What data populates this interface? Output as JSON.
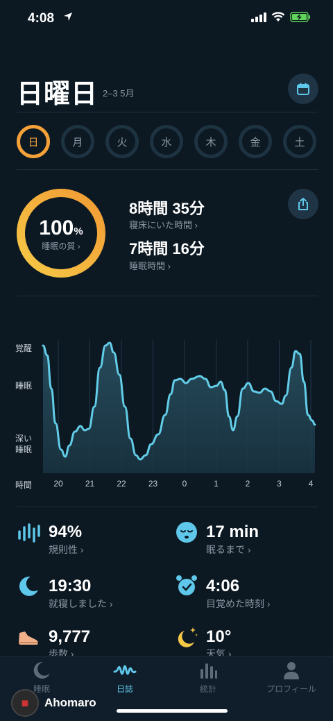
{
  "status_bar": {
    "time": "4:08"
  },
  "header": {
    "title": "日曜日",
    "date_range": "2–3 5月"
  },
  "days": [
    "日",
    "月",
    "火",
    "水",
    "木",
    "金",
    "土"
  ],
  "selected_day_index": 0,
  "summary": {
    "quality_value": "100",
    "quality_unit": "%",
    "quality_label": "睡眠の質 ›",
    "quality_fraction": 1.0,
    "time_in_bed": "8時間 35分",
    "time_in_bed_label": "寝床にいた時間 ›",
    "sleep_time": "7時間 16分",
    "sleep_time_label": "睡眠時間 ›"
  },
  "graph": {
    "y_labels": {
      "awake": "覚醒",
      "sleep": "睡眠",
      "deep": "深い\n睡眠"
    },
    "x_title": "時間",
    "hours": [
      "20",
      "21",
      "22",
      "23",
      "0",
      "1",
      "2",
      "3",
      "4"
    ]
  },
  "metrics": [
    {
      "value": "94%",
      "label": "規則性 ›",
      "icon": "regularity-icon"
    },
    {
      "value": "17 min",
      "label": "眠るまで ›",
      "icon": "sleepy-face-icon"
    },
    {
      "value": "19:30",
      "label": "就寝しました ›",
      "icon": "moon-icon"
    },
    {
      "value": "4:06",
      "label": "目覚めた時刻 ›",
      "icon": "alarm-clock-icon"
    },
    {
      "value": "9,777",
      "label": "歩数 ›",
      "icon": "shoe-icon"
    },
    {
      "value": "10°",
      "label": "天気 ›",
      "icon": "moon-stars-icon"
    }
  ],
  "tabs": [
    {
      "label": "睡眠",
      "active": false
    },
    {
      "label": "日誌",
      "active": true
    },
    {
      "label": "統計",
      "active": false
    },
    {
      "label": "プロフィール",
      "active": false
    }
  ],
  "watermark": {
    "text": "Ahomaro"
  },
  "colors": {
    "accent_orange": "#f4a139",
    "accent_blue": "#5ec7ea",
    "background": "#0c1822"
  }
}
